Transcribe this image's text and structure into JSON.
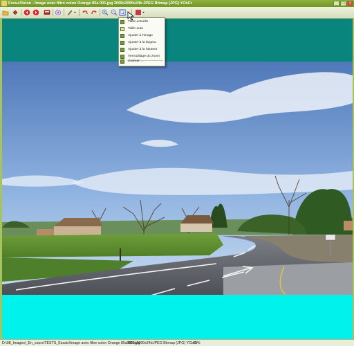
{
  "window": {
    "title": "FocusVision - Image avec filtre colon Orange 85a 001.jpg   3008x2000x24b   JPEG Bitmap (JPG) YCbCr"
  },
  "titlebar_buttons": {
    "minimize": "_",
    "maximize": "□",
    "close": "×"
  },
  "toolbar": {
    "buttons": [
      {
        "name": "open-icon",
        "color": "#c0392b"
      },
      {
        "name": "settings-icon",
        "color": "#a0522d"
      },
      {
        "name": "prev-icon",
        "color": "#d9262b"
      },
      {
        "name": "next-icon",
        "color": "#d9262b"
      },
      {
        "name": "slideshow-icon",
        "color": "#b51e1e"
      },
      {
        "name": "filter-icon",
        "color": "#8f6fc5"
      },
      {
        "name": "brush-icon",
        "color": "#6b5a3b"
      },
      {
        "name": "undo-icon",
        "color": "#d33"
      },
      {
        "name": "redo-icon",
        "color": "#d33"
      },
      {
        "name": "zoom-in-icon",
        "color": "#5a6fb0"
      },
      {
        "name": "zoom-out-icon",
        "color": "#5a6fb0"
      },
      {
        "name": "zoom-menu-icon",
        "color": "#5a6fb0"
      },
      {
        "name": "color-icon",
        "color": "#d32f4a"
      }
    ]
  },
  "zoom_menu": {
    "items": [
      {
        "label": "Taille actuelle",
        "checked": false
      },
      {
        "label": "Taille auto",
        "checked": true
      },
      {
        "label": "Ajuster à l'image",
        "checked": false
      },
      {
        "label": "Ajuster à la largeur",
        "checked": false
      },
      {
        "label": "Ajuster à la hauteur",
        "checked": false
      },
      {
        "label": "Verrouillage du zoom",
        "checked": false
      },
      {
        "label": "Zoomer ...",
        "checked": false
      }
    ]
  },
  "viewer": {
    "background_top": "#09857e",
    "background_bottom": "#00f2ec"
  },
  "statusbar": {
    "path": "D:\\08_Images\\_En_cours\\TESTS_Essais\\Image avec filtre colon Orange 85a 001.jpg",
    "dimensions": "3008x2000x24b",
    "format": "JPEG Bitmap (JPG) YCbCr",
    "zoom": "40%"
  }
}
